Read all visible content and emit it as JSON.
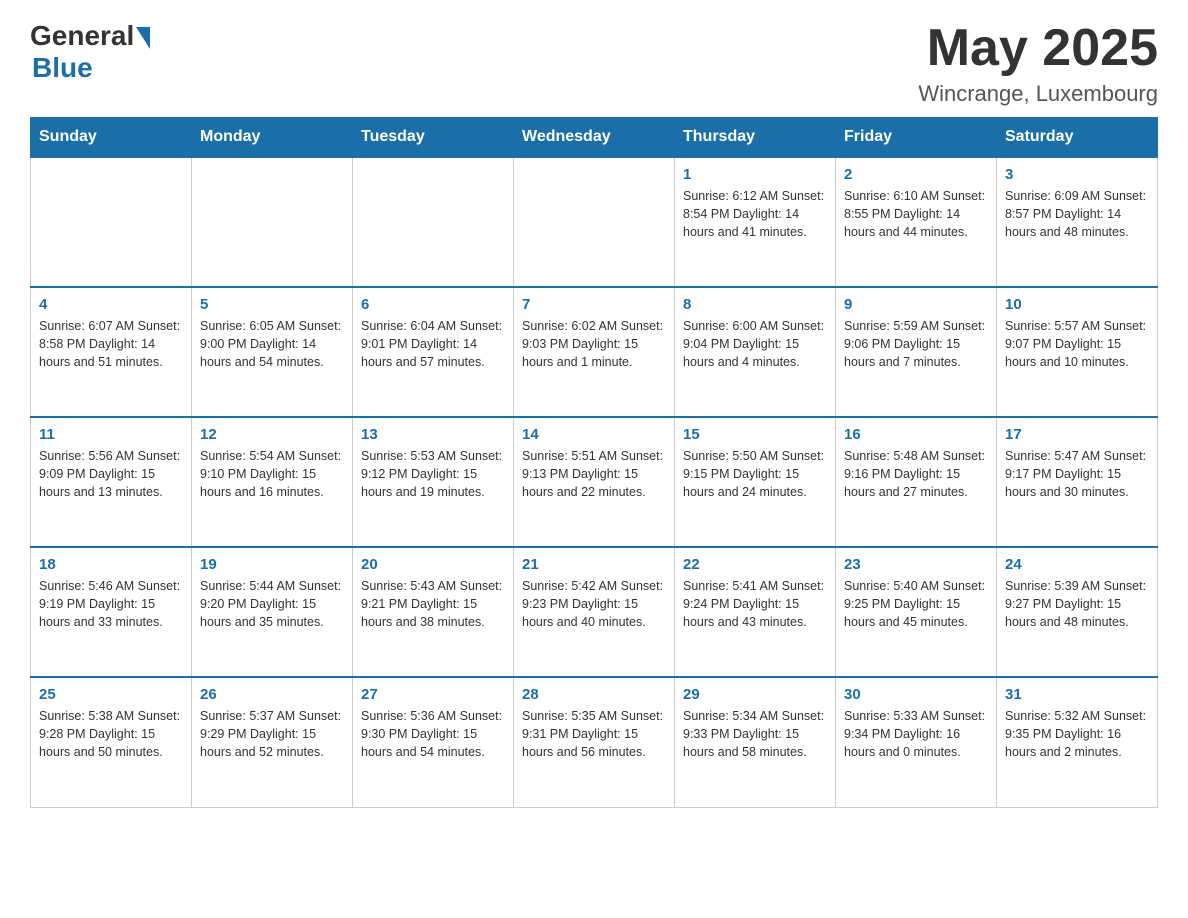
{
  "header": {
    "logo_general": "General",
    "logo_blue": "Blue",
    "month_title": "May 2025",
    "location": "Wincrange, Luxembourg"
  },
  "weekdays": [
    "Sunday",
    "Monday",
    "Tuesday",
    "Wednesday",
    "Thursday",
    "Friday",
    "Saturday"
  ],
  "weeks": [
    [
      {
        "day": "",
        "info": ""
      },
      {
        "day": "",
        "info": ""
      },
      {
        "day": "",
        "info": ""
      },
      {
        "day": "",
        "info": ""
      },
      {
        "day": "1",
        "info": "Sunrise: 6:12 AM\nSunset: 8:54 PM\nDaylight: 14 hours\nand 41 minutes."
      },
      {
        "day": "2",
        "info": "Sunrise: 6:10 AM\nSunset: 8:55 PM\nDaylight: 14 hours\nand 44 minutes."
      },
      {
        "day": "3",
        "info": "Sunrise: 6:09 AM\nSunset: 8:57 PM\nDaylight: 14 hours\nand 48 minutes."
      }
    ],
    [
      {
        "day": "4",
        "info": "Sunrise: 6:07 AM\nSunset: 8:58 PM\nDaylight: 14 hours\nand 51 minutes."
      },
      {
        "day": "5",
        "info": "Sunrise: 6:05 AM\nSunset: 9:00 PM\nDaylight: 14 hours\nand 54 minutes."
      },
      {
        "day": "6",
        "info": "Sunrise: 6:04 AM\nSunset: 9:01 PM\nDaylight: 14 hours\nand 57 minutes."
      },
      {
        "day": "7",
        "info": "Sunrise: 6:02 AM\nSunset: 9:03 PM\nDaylight: 15 hours\nand 1 minute."
      },
      {
        "day": "8",
        "info": "Sunrise: 6:00 AM\nSunset: 9:04 PM\nDaylight: 15 hours\nand 4 minutes."
      },
      {
        "day": "9",
        "info": "Sunrise: 5:59 AM\nSunset: 9:06 PM\nDaylight: 15 hours\nand 7 minutes."
      },
      {
        "day": "10",
        "info": "Sunrise: 5:57 AM\nSunset: 9:07 PM\nDaylight: 15 hours\nand 10 minutes."
      }
    ],
    [
      {
        "day": "11",
        "info": "Sunrise: 5:56 AM\nSunset: 9:09 PM\nDaylight: 15 hours\nand 13 minutes."
      },
      {
        "day": "12",
        "info": "Sunrise: 5:54 AM\nSunset: 9:10 PM\nDaylight: 15 hours\nand 16 minutes."
      },
      {
        "day": "13",
        "info": "Sunrise: 5:53 AM\nSunset: 9:12 PM\nDaylight: 15 hours\nand 19 minutes."
      },
      {
        "day": "14",
        "info": "Sunrise: 5:51 AM\nSunset: 9:13 PM\nDaylight: 15 hours\nand 22 minutes."
      },
      {
        "day": "15",
        "info": "Sunrise: 5:50 AM\nSunset: 9:15 PM\nDaylight: 15 hours\nand 24 minutes."
      },
      {
        "day": "16",
        "info": "Sunrise: 5:48 AM\nSunset: 9:16 PM\nDaylight: 15 hours\nand 27 minutes."
      },
      {
        "day": "17",
        "info": "Sunrise: 5:47 AM\nSunset: 9:17 PM\nDaylight: 15 hours\nand 30 minutes."
      }
    ],
    [
      {
        "day": "18",
        "info": "Sunrise: 5:46 AM\nSunset: 9:19 PM\nDaylight: 15 hours\nand 33 minutes."
      },
      {
        "day": "19",
        "info": "Sunrise: 5:44 AM\nSunset: 9:20 PM\nDaylight: 15 hours\nand 35 minutes."
      },
      {
        "day": "20",
        "info": "Sunrise: 5:43 AM\nSunset: 9:21 PM\nDaylight: 15 hours\nand 38 minutes."
      },
      {
        "day": "21",
        "info": "Sunrise: 5:42 AM\nSunset: 9:23 PM\nDaylight: 15 hours\nand 40 minutes."
      },
      {
        "day": "22",
        "info": "Sunrise: 5:41 AM\nSunset: 9:24 PM\nDaylight: 15 hours\nand 43 minutes."
      },
      {
        "day": "23",
        "info": "Sunrise: 5:40 AM\nSunset: 9:25 PM\nDaylight: 15 hours\nand 45 minutes."
      },
      {
        "day": "24",
        "info": "Sunrise: 5:39 AM\nSunset: 9:27 PM\nDaylight: 15 hours\nand 48 minutes."
      }
    ],
    [
      {
        "day": "25",
        "info": "Sunrise: 5:38 AM\nSunset: 9:28 PM\nDaylight: 15 hours\nand 50 minutes."
      },
      {
        "day": "26",
        "info": "Sunrise: 5:37 AM\nSunset: 9:29 PM\nDaylight: 15 hours\nand 52 minutes."
      },
      {
        "day": "27",
        "info": "Sunrise: 5:36 AM\nSunset: 9:30 PM\nDaylight: 15 hours\nand 54 minutes."
      },
      {
        "day": "28",
        "info": "Sunrise: 5:35 AM\nSunset: 9:31 PM\nDaylight: 15 hours\nand 56 minutes."
      },
      {
        "day": "29",
        "info": "Sunrise: 5:34 AM\nSunset: 9:33 PM\nDaylight: 15 hours\nand 58 minutes."
      },
      {
        "day": "30",
        "info": "Sunrise: 5:33 AM\nSunset: 9:34 PM\nDaylight: 16 hours\nand 0 minutes."
      },
      {
        "day": "31",
        "info": "Sunrise: 5:32 AM\nSunset: 9:35 PM\nDaylight: 16 hours\nand 2 minutes."
      }
    ]
  ]
}
